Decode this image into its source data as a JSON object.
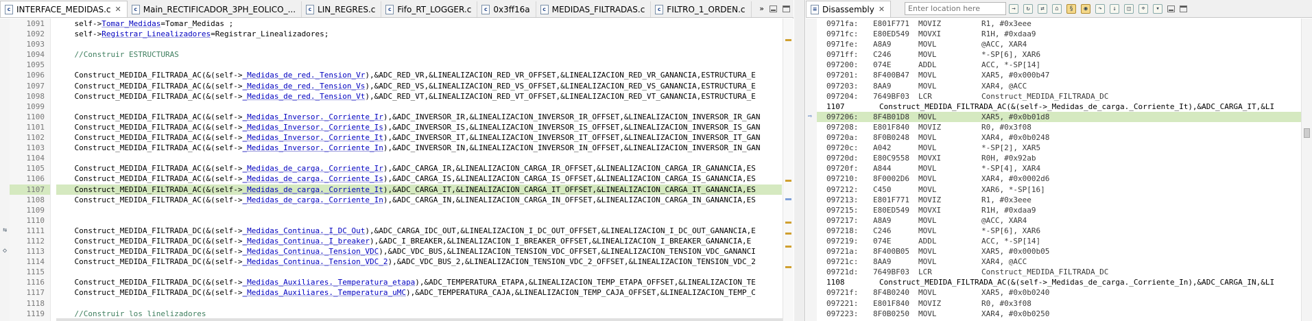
{
  "editor": {
    "tabs": [
      {
        "label": "INTERFACE_MEDIDAS.c",
        "active": true,
        "closable": true
      },
      {
        "label": "Main_RECTIFICADOR_3PH_EOLICO_..."
      },
      {
        "label": "LIN_REGRES.c"
      },
      {
        "label": "Fifo_RT_LOGGER.c"
      },
      {
        "label": "0x3ff16a"
      },
      {
        "label": "MEDIDAS_FILTRADAS.c"
      },
      {
        "label": "FILTRO_1_ORDEN.c"
      }
    ],
    "close_glyph": "✕",
    "overflow": "»",
    "lines": [
      {
        "n": "1091",
        "parts": [
          {
            "t": "    self->"
          },
          {
            "t": "Tomar_Medidas",
            "c": "mem"
          },
          {
            "t": "=Tomar_Medidas ;"
          }
        ]
      },
      {
        "n": "1092",
        "parts": [
          {
            "t": "    self->"
          },
          {
            "t": "Registrar_Linealizadores",
            "c": "mem"
          },
          {
            "t": "=Registrar_Linealizadores;"
          }
        ]
      },
      {
        "n": "1093",
        "parts": []
      },
      {
        "n": "1094",
        "parts": [
          {
            "t": "    //Construir ESTRUCTURAS",
            "c": "cmt"
          }
        ]
      },
      {
        "n": "1095",
        "parts": []
      },
      {
        "n": "1096",
        "parts": [
          {
            "t": "    Construct_MEDIDA_FILTRADA_AC(&(self->"
          },
          {
            "t": "_Medidas_de_red.",
            "c": "mem"
          },
          {
            "t": "_Tension_Vr",
            "c": "mem"
          },
          {
            "t": "),&ADC_RED_VR,&LINEALIZACION_RED_VR_OFFSET,&LINEALIZACION_RED_VR_GANANCIA,ESTRUCTURA_E"
          }
        ]
      },
      {
        "n": "1097",
        "parts": [
          {
            "t": "    Construct_MEDIDA_FILTRADA_AC(&(self->"
          },
          {
            "t": "_Medidas_de_red.",
            "c": "mem"
          },
          {
            "t": "_Tension_Vs",
            "c": "mem"
          },
          {
            "t": "),&ADC_RED_VS,&LINEALIZACION_RED_VS_OFFSET,&LINEALIZACION_RED_VS_GANANCIA,ESTRUCTURA_E"
          }
        ]
      },
      {
        "n": "1098",
        "parts": [
          {
            "t": "    Construct_MEDIDA_FILTRADA_AC(&(self->"
          },
          {
            "t": "_Medidas_de_red.",
            "c": "mem"
          },
          {
            "t": "_Tension_Vt",
            "c": "mem"
          },
          {
            "t": "),&ADC_RED_VT,&LINEALIZACION_RED_VT_OFFSET,&LINEALIZACION_RED_VT_GANANCIA,ESTRUCTURA_E"
          }
        ]
      },
      {
        "n": "1099",
        "parts": []
      },
      {
        "n": "1100",
        "parts": [
          {
            "t": "    Construct_MEDIDA_FILTRADA_AC(&(self->"
          },
          {
            "t": "_Medidas_Inversor.",
            "c": "mem"
          },
          {
            "t": "_Corriente_Ir",
            "c": "mem"
          },
          {
            "t": "),&ADC_INVERSOR_IR,&LINEALIZACION_INVERSOR_IR_OFFSET,&LINEALIZACION_INVERSOR_IR_GAN"
          }
        ]
      },
      {
        "n": "1101",
        "parts": [
          {
            "t": "    Construct_MEDIDA_FILTRADA_AC(&(self->"
          },
          {
            "t": "_Medidas_Inversor.",
            "c": "mem"
          },
          {
            "t": "_Corriente_Is",
            "c": "mem"
          },
          {
            "t": "),&ADC_INVERSOR_IS,&LINEALIZACION_INVERSOR_IS_OFFSET,&LINEALIZACION_INVERSOR_IS_GAN"
          }
        ]
      },
      {
        "n": "1102",
        "parts": [
          {
            "t": "    Construct_MEDIDA_FILTRADA_AC(&(self->"
          },
          {
            "t": "_Medidas_Inversor.",
            "c": "mem"
          },
          {
            "t": "_Corriente_It",
            "c": "mem"
          },
          {
            "t": "),&ADC_INVERSOR_IT,&LINEALIZACION_INVERSOR_IT_OFFSET,&LINEALIZACION_INVERSOR_IT_GAN"
          }
        ]
      },
      {
        "n": "1103",
        "parts": [
          {
            "t": "    Construct_MEDIDA_FILTRADA_AC(&(self->"
          },
          {
            "t": "_Medidas_Inversor.",
            "c": "mem"
          },
          {
            "t": "_Corriente_In",
            "c": "mem"
          },
          {
            "t": "),&ADC_INVERSOR_IN,&LINEALIZACION_INVERSOR_IN_OFFSET,&LINEALIZACION_INVERSOR_IN_GAN"
          }
        ]
      },
      {
        "n": "1104",
        "parts": []
      },
      {
        "n": "1105",
        "parts": [
          {
            "t": "    Construct_MEDIDA_FILTRADA_AC(&(self->"
          },
          {
            "t": "_Medidas_de_carga.",
            "c": "mem"
          },
          {
            "t": "_Corriente_Ir",
            "c": "mem"
          },
          {
            "t": "),&ADC_CARGA_IR,&LINEALIZACION_CARGA_IR_OFFSET,&LINEALIZACION_CARGA_IR_GANANCIA,ES"
          }
        ]
      },
      {
        "n": "1106",
        "parts": [
          {
            "t": "    Construct_MEDIDA_FILTRADA_AC(&(self->"
          },
          {
            "t": "_Medidas_de_carga.",
            "c": "mem"
          },
          {
            "t": "_Corriente_Is",
            "c": "mem"
          },
          {
            "t": "),&ADC_CARGA_IS,&LINEALIZACION_CARGA_IS_OFFSET,&LINEALIZACION_CARGA_IS_GANANCIA,ES"
          }
        ]
      },
      {
        "n": "1107",
        "hl": true,
        "parts": [
          {
            "t": "    Construct_MEDIDA_FILTRADA_AC(&(self->"
          },
          {
            "t": "_Medidas_de_carga.",
            "c": "mem"
          },
          {
            "t": "_Corriente_It",
            "c": "mem"
          },
          {
            "t": "),&ADC_CARGA_IT,&LINEALIZACION_CARGA_IT_OFFSET,&LINEALIZACION_CARGA_IT_GANANCIA,ES"
          }
        ]
      },
      {
        "n": "1108",
        "parts": [
          {
            "t": "    Construct_MEDIDA_FILTRADA_AC(&(self->"
          },
          {
            "t": "_Medidas_de_carga.",
            "c": "mem"
          },
          {
            "t": "_Corriente_In",
            "c": "mem"
          },
          {
            "t": "),&ADC_CARGA_IN,&LINEALIZACION_CARGA_IN_OFFSET,&LINEALIZACION_CARGA_IN_GANANCIA,ES"
          }
        ]
      },
      {
        "n": "1109",
        "parts": []
      },
      {
        "n": "1110",
        "parts": []
      },
      {
        "n": "1111",
        "parts": [
          {
            "t": "    Construct_MEDIDA_FILTRADA_DC(&(self->"
          },
          {
            "t": "_Medidas_Continua.",
            "c": "mem"
          },
          {
            "t": "_I_DC_Out",
            "c": "mem"
          },
          {
            "t": "),&ADC_CARGA_IDC_OUT,&LINEALIZACION_I_DC_OUT_OFFSET,&LINEALIZACION_I_DC_OUT_GANANCIA,E"
          }
        ]
      },
      {
        "n": "1112",
        "parts": [
          {
            "t": "    Construct_MEDIDA_FILTRADA_DC(&(self->"
          },
          {
            "t": "_Medidas_Continua.",
            "c": "mem"
          },
          {
            "t": "_I_breaker",
            "c": "mem"
          },
          {
            "t": "),&ADC_I_BREAKER,&LINEALIZACION_I_BREAKER_OFFSET,&LINEALIZACION_I_BREAKER_GANANCIA,E"
          }
        ]
      },
      {
        "n": "1113",
        "parts": [
          {
            "t": "    Construct_MEDIDA_FILTRADA_DC(&(self->"
          },
          {
            "t": "_Medidas_Continua.",
            "c": "mem"
          },
          {
            "t": "_Tension_VDC",
            "c": "mem"
          },
          {
            "t": "),&ADC_VDC_BUS,&LINEALIZACION_TENSION_VDC_OFFSET,&LINEALIZACION_TENSION_VDC_GANANCI"
          }
        ]
      },
      {
        "n": "1114",
        "parts": [
          {
            "t": "    Construct_MEDIDA_FILTRADA_DC(&(self->"
          },
          {
            "t": "_Medidas_Continua.",
            "c": "mem"
          },
          {
            "t": "_Tension_VDC_2",
            "c": "mem"
          },
          {
            "t": "),&ADC_VDC_BUS_2,&LINEALIZACION_TENSION_VDC_2_OFFSET,&LINEALIZACION_TENSION_VDC_2"
          }
        ]
      },
      {
        "n": "1115",
        "parts": []
      },
      {
        "n": "1116",
        "parts": [
          {
            "t": "    Construct_MEDIDA_FILTRADA_DC(&(self->"
          },
          {
            "t": "_Medidas_Auxiliares.",
            "c": "mem"
          },
          {
            "t": "_Temperatura_etapa",
            "c": "mem"
          },
          {
            "t": "),&ADC_TEMPERATURA_ETAPA,&LINEALIZACION_TEMP_ETAPA_OFFSET,&LINEALIZACION_TE"
          }
        ]
      },
      {
        "n": "1117",
        "parts": [
          {
            "t": "    Construct_MEDIDA_FILTRADA_DC(&(self->"
          },
          {
            "t": "_Medidas_Auxiliares.",
            "c": "mem"
          },
          {
            "t": "_Temperatura_uMC",
            "c": "mem"
          },
          {
            "t": "),&ADC_TEMPERATURA_CAJA,&LINEALIZACION_TEMP_CAJA_OFFSET,&LINEALIZACION_TEMP_C"
          }
        ]
      },
      {
        "n": "1118",
        "parts": []
      },
      {
        "n": "1119",
        "parts": [
          {
            "t": "    //Construir los linelizadores",
            "c": "cmt"
          }
        ]
      }
    ]
  },
  "disassembly": {
    "tab_label": "Disassembly",
    "close_glyph": "✕",
    "location_placeholder": "Enter location here",
    "rows": [
      {
        "type": "asm",
        "addr": "0971fa:",
        "op": "E801F771",
        "mn": "MOVIZ",
        "arg": "R1, #0x3eee"
      },
      {
        "type": "asm",
        "addr": "0971fc:",
        "op": "E80ED549",
        "mn": "MOVXI",
        "arg": "R1H, #0xdaa9"
      },
      {
        "type": "asm",
        "addr": "0971fe:",
        "op": "A8A9",
        "mn": "MOVL",
        "arg": "@ACC, XAR4"
      },
      {
        "type": "asm",
        "addr": "0971ff:",
        "op": "C246",
        "mn": "MOVL",
        "arg": "*-SP[6], XAR6"
      },
      {
        "type": "asm",
        "addr": "097200:",
        "op": "074E",
        "mn": "ADDL",
        "arg": "ACC, *-SP[14]"
      },
      {
        "type": "asm",
        "addr": "097201:",
        "op": "8F400B47",
        "mn": "MOVL",
        "arg": "XAR5, #0x000b47"
      },
      {
        "type": "asm",
        "addr": "097203:",
        "op": "8AA9",
        "mn": "MOVL",
        "arg": "XAR4, @ACC"
      },
      {
        "type": "asm",
        "addr": "097204:",
        "op": "7649BF03",
        "mn": "LCR",
        "arg": "Construct_MEDIDA_FILTRADA_DC"
      },
      {
        "type": "src",
        "ln": "1107",
        "text": "        Construct_MEDIDA_FILTRADA_AC(&(self->_Medidas_de_carga._Corriente_It),&ADC_CARGA_IT,&LI"
      },
      {
        "type": "asm",
        "addr": "097206:",
        "op": "8F4B01D8",
        "mn": "MOVL",
        "arg": "XAR5, #0x0b01d8",
        "hl": true
      },
      {
        "type": "asm",
        "addr": "097208:",
        "op": "E801F840",
        "mn": "MOVIZ",
        "arg": "R0, #0x3f08"
      },
      {
        "type": "asm",
        "addr": "09720a:",
        "op": "8F0B0248",
        "mn": "MOVL",
        "arg": "XAR4, #0x0b0248"
      },
      {
        "type": "asm",
        "addr": "09720c:",
        "op": "A042",
        "mn": "MOVL",
        "arg": "*-SP[2], XAR5"
      },
      {
        "type": "asm",
        "addr": "09720d:",
        "op": "E80C9558",
        "mn": "MOVXI",
        "arg": "R0H, #0x92ab"
      },
      {
        "type": "asm",
        "addr": "09720f:",
        "op": "A844",
        "mn": "MOVL",
        "arg": "*-SP[4], XAR4"
      },
      {
        "type": "asm",
        "addr": "097210:",
        "op": "8F0002D6",
        "mn": "MOVL",
        "arg": "XAR4, #0x0002d6"
      },
      {
        "type": "asm",
        "addr": "097212:",
        "op": "C450",
        "mn": "MOVL",
        "arg": "XAR6, *-SP[16]"
      },
      {
        "type": "asm",
        "addr": "097213:",
        "op": "E801F771",
        "mn": "MOVIZ",
        "arg": "R1, #0x3eee"
      },
      {
        "type": "asm",
        "addr": "097215:",
        "op": "E80ED549",
        "mn": "MOVXI",
        "arg": "R1H, #0xdaa9"
      },
      {
        "type": "asm",
        "addr": "097217:",
        "op": "A8A9",
        "mn": "MOVL",
        "arg": "@ACC, XAR4"
      },
      {
        "type": "asm",
        "addr": "097218:",
        "op": "C246",
        "mn": "MOVL",
        "arg": "*-SP[6], XAR6"
      },
      {
        "type": "asm",
        "addr": "097219:",
        "op": "074E",
        "mn": "ADDL",
        "arg": "ACC, *-SP[14]"
      },
      {
        "type": "asm",
        "addr": "09721a:",
        "op": "8F400B05",
        "mn": "MOVL",
        "arg": "XAR5, #0x000b05"
      },
      {
        "type": "asm",
        "addr": "09721c:",
        "op": "8AA9",
        "mn": "MOVL",
        "arg": "XAR4, @ACC"
      },
      {
        "type": "asm",
        "addr": "09721d:",
        "op": "7649BF03",
        "mn": "LCR",
        "arg": "Construct_MEDIDA_FILTRADA_DC"
      },
      {
        "type": "src",
        "ln": "1108",
        "text": "        Construct_MEDIDA_FILTRADA_AC(&(self->_Medidas_de_carga._Corriente_In),&ADC_CARGA_IN,&LI"
      },
      {
        "type": "asm",
        "addr": "09721f:",
        "op": "8F4B0240",
        "mn": "MOVL",
        "arg": "XAR5, #0x0b0240"
      },
      {
        "type": "asm",
        "addr": "097221:",
        "op": "E801F840",
        "mn": "MOVIZ",
        "arg": "R0, #0x3f08"
      },
      {
        "type": "asm",
        "addr": "097223:",
        "op": "8F0B0250",
        "mn": "MOVL",
        "arg": "XAR4, #0x0b0250"
      }
    ]
  },
  "colors": {
    "current_line": "#d5e9c0",
    "comment": "#3f7f5f",
    "member": "#0000c0"
  }
}
